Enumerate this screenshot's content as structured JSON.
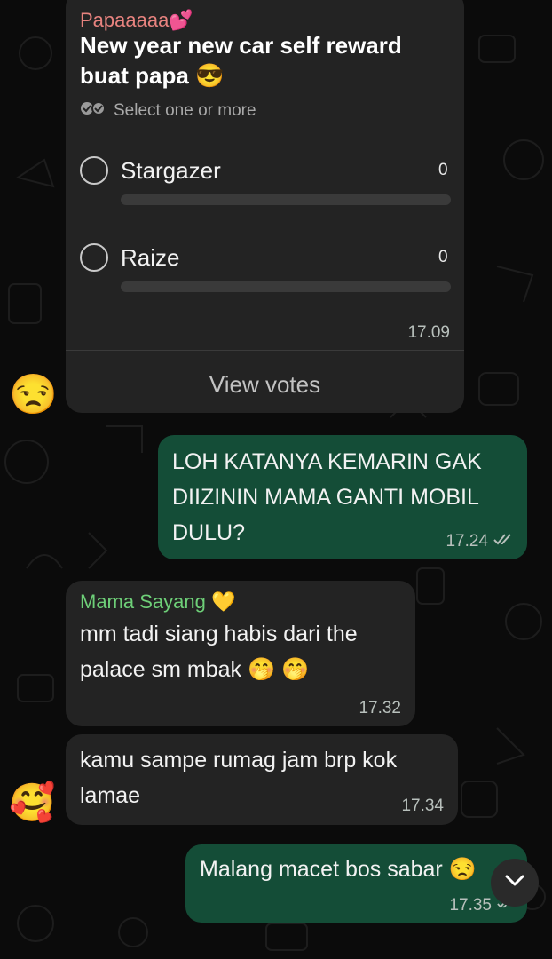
{
  "poll": {
    "sender": "Papaaaaa💕",
    "question": "New year new car self reward buat papa 😎",
    "hint": "Select one or more",
    "options": [
      {
        "label": "Stargazer",
        "count": "0"
      },
      {
        "label": "Raize",
        "count": "0"
      }
    ],
    "time": "17.09",
    "view_votes": "View votes",
    "avatar": "😒"
  },
  "messages": [
    {
      "direction": "out",
      "text": "LOH KATANYA KEMARIN GAK DIIZININ MAMA GANTI MOBIL DULU?",
      "time": "17.24",
      "status": "read"
    },
    {
      "direction": "in",
      "sender": "Mama Sayang 💛",
      "text": "mm tadi siang habis dari the palace sm mbak 🤭 🤭",
      "time": "17.32"
    },
    {
      "direction": "in",
      "text": "kamu sampe rumag jam brp kok lamae",
      "time": "17.34",
      "avatar": "🥰"
    },
    {
      "direction": "out",
      "text": "Malang macet bos sabar 😒",
      "time": "17.35",
      "status": "delivered"
    }
  ],
  "colors": {
    "incoming_bubble": "#232323",
    "outgoing_bubble": "#144d37",
    "poll_sender": "#e8837f",
    "mama_sender": "#6ecf78"
  },
  "icons": {
    "scroll_down": "chevron-down-icon",
    "read_receipt": "double-check-icon"
  }
}
